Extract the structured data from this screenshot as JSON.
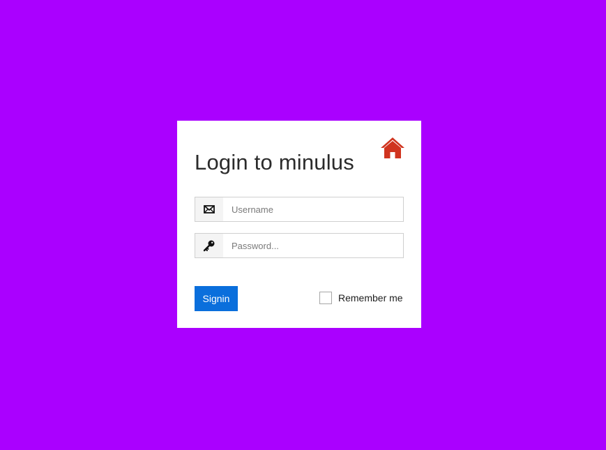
{
  "page": {
    "background_color": "#aa00ff"
  },
  "login": {
    "title": "Login to minulus",
    "home_icon": "home-icon",
    "username": {
      "icon": "envelope-icon",
      "placeholder": "Username",
      "value": ""
    },
    "password": {
      "icon": "key-icon",
      "placeholder": "Password...",
      "value": ""
    },
    "signin_label": "Signin",
    "remember_label": "Remember me",
    "remember_checked": false
  },
  "colors": {
    "accent": "#0a6fdc",
    "home_icon": "#d0341f",
    "card": "#ffffff"
  }
}
